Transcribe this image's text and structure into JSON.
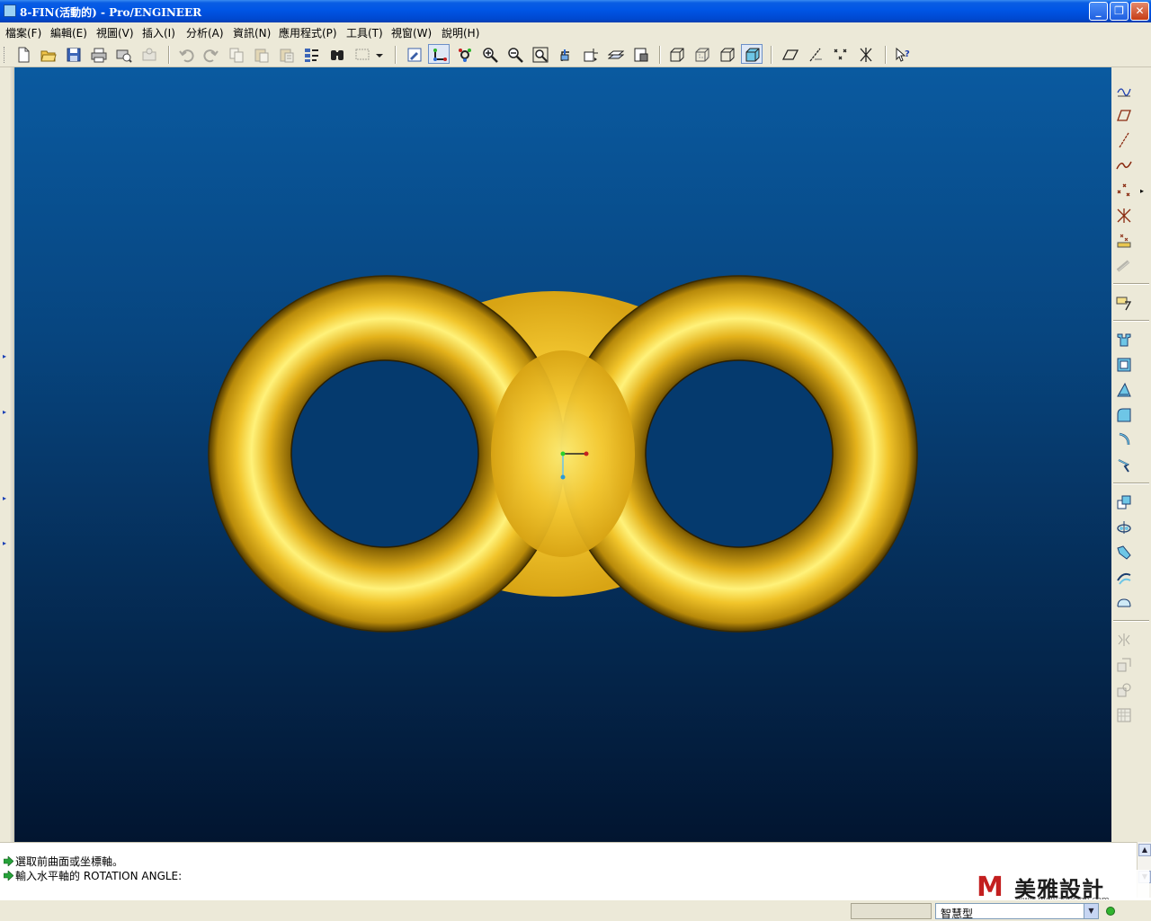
{
  "window": {
    "title": "8-FIN(活動的) - Pro/ENGINEER",
    "minimize_glyph": "_",
    "maximize_glyph": "❐",
    "close_glyph": "✕"
  },
  "menu": {
    "items": [
      {
        "label": "檔案(F)"
      },
      {
        "label": "編輯(E)"
      },
      {
        "label": "視圖(V)"
      },
      {
        "label": "插入(I)"
      },
      {
        "label": "分析(A)"
      },
      {
        "label": "資訊(N)"
      },
      {
        "label": "應用程式(P)"
      },
      {
        "label": "工具(T)"
      },
      {
        "label": "視窗(W)"
      },
      {
        "label": "說明(H)"
      }
    ]
  },
  "toolbar": {
    "icons": [
      "new-file-icon",
      "open-file-icon",
      "save-icon",
      "print-icon",
      "print-preview-icon",
      "email-icon",
      "undo-icon",
      "redo-icon",
      "copy-icon",
      "paste-icon",
      "paste-special-icon",
      "regenerate-icon",
      "find-icon",
      "select-box-icon",
      "dropdown-icon",
      "repaint-icon",
      "spin-center-icon",
      "orient-mode-icon",
      "zoom-in-icon",
      "zoom-out-icon",
      "refit-icon",
      "reorient-icon",
      "saved-views-icon",
      "layers-icon",
      "model-setup-icon",
      "wireframe-icon",
      "hidden-line-icon",
      "no-hidden-icon",
      "shading-icon",
      "datum-planes-icon",
      "datum-axes-icon",
      "datum-points-icon",
      "coordinate-systems-icon",
      "context-help-icon"
    ]
  },
  "right_toolbar": {
    "icons": [
      "sketch-datum-curve-icon",
      "datum-plane-icon",
      "datum-axis-icon",
      "datum-curve-icon",
      "datum-point-icon",
      "datum-coordinate-system-icon",
      "analysis-feature-icon",
      "datum-flyout-icon",
      "sketch-tool-icon",
      "extrude-icon",
      "revolve-icon",
      "draft-icon",
      "round-icon",
      "chamfer-icon",
      "rib-icon",
      "shell-icon",
      "hole-icon",
      "pattern-icon",
      "sweep-icon",
      "blend-icon",
      "boundary-blend-icon",
      "mirror-icon",
      "merge-icon",
      "trim-icon",
      "intersect-icon"
    ]
  },
  "messages": {
    "line1": "選取前曲面或坐標軸。",
    "line2": "輸入水平軸的 ROTATION ANGLE:"
  },
  "status": {
    "filter_value": "智慧型"
  },
  "watermark": {
    "logo_letter": "M",
    "name": "美雅設計",
    "url": "www.meiyadesign.com"
  },
  "colors": {
    "canvas_top": "#0a5aa0",
    "canvas_bottom": "#021530",
    "model_gold": "#e7b419",
    "title_blue": "#0055e5"
  }
}
